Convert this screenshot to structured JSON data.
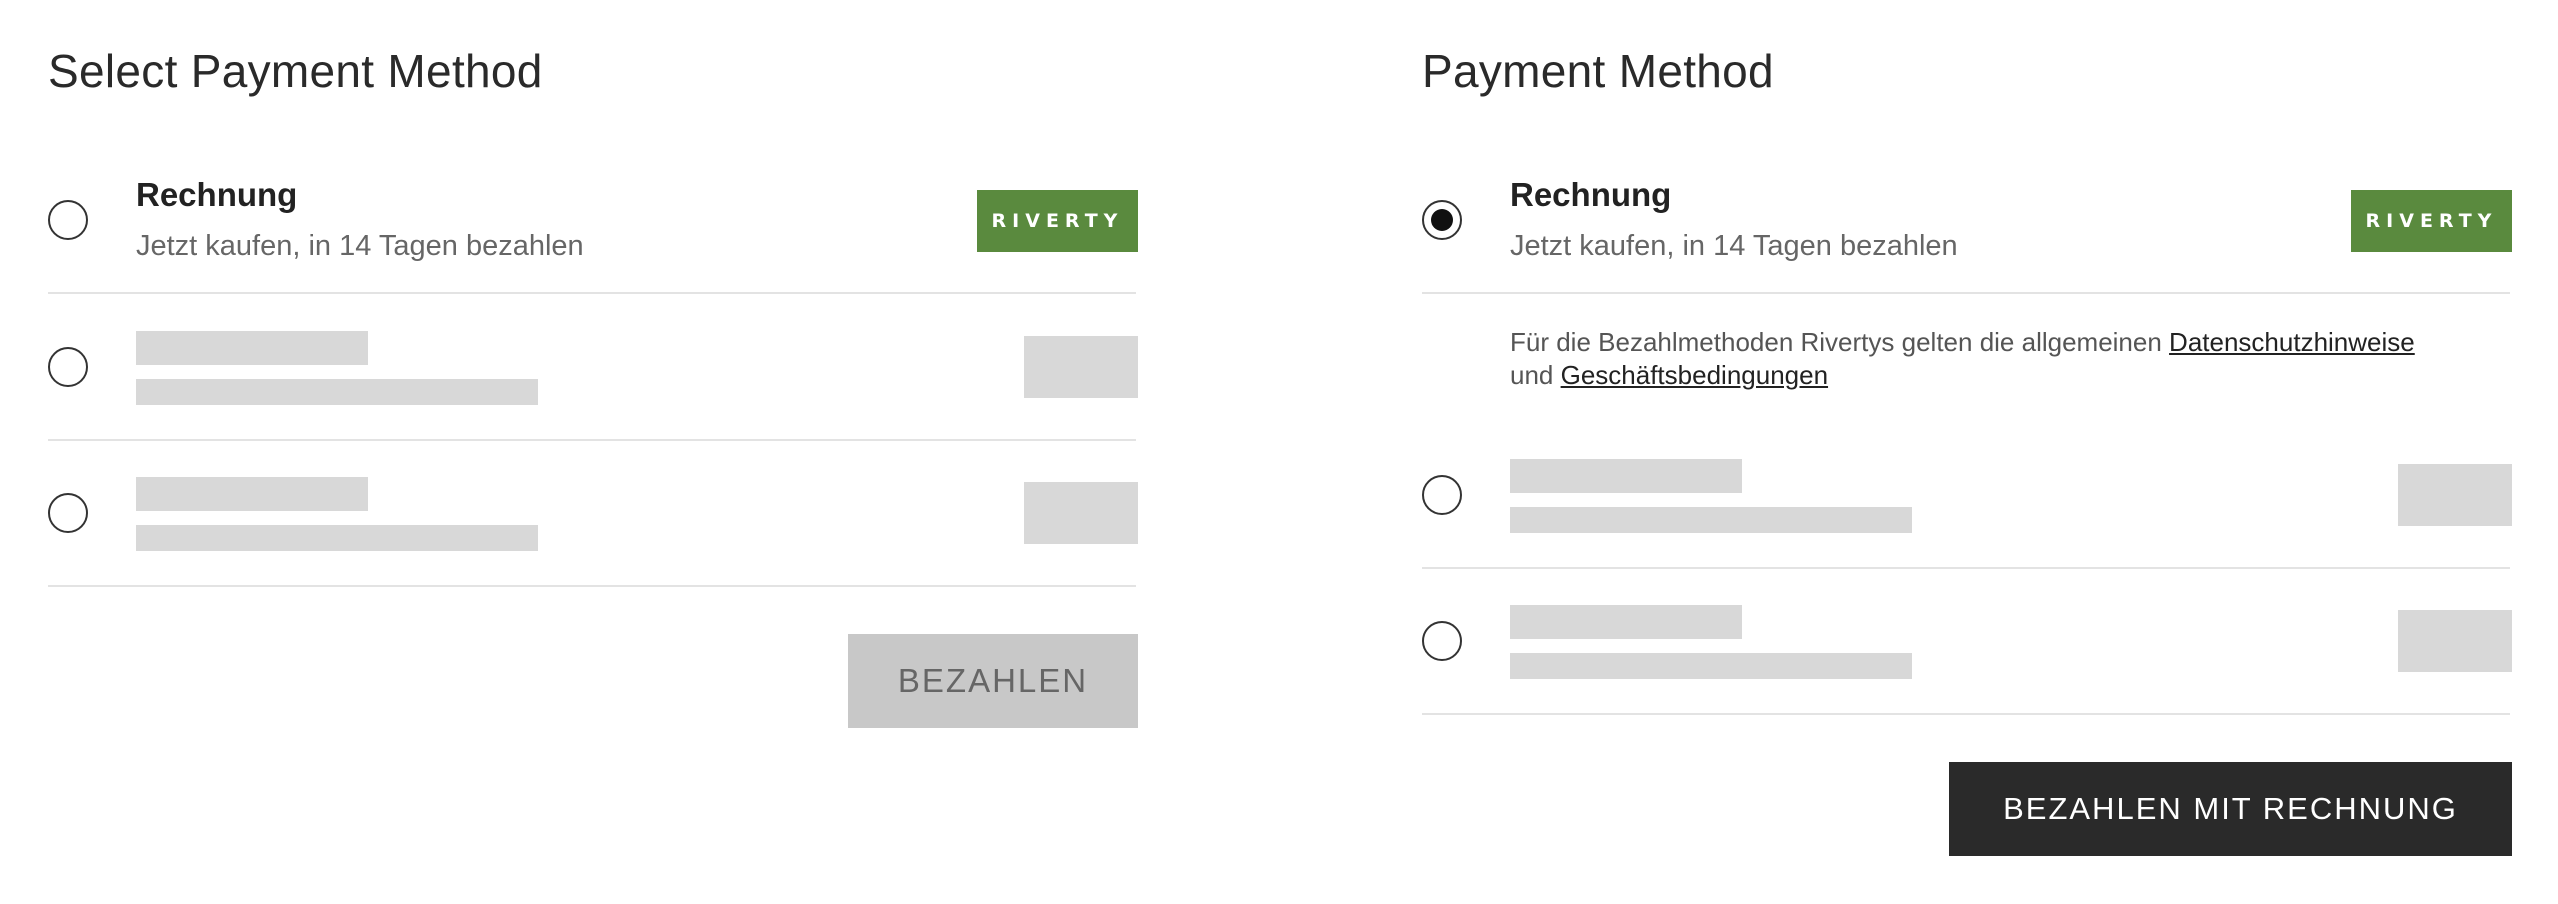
{
  "left_panel": {
    "title": "Select Payment Method",
    "options": [
      {
        "title": "Rechnung",
        "subtitle": "Jetzt kaufen, in 14 Tagen bezahlen",
        "selected": false,
        "logo_text": "RIVERTY",
        "logo_color": "#5a8a3e"
      },
      {
        "placeholder": true,
        "selected": false
      },
      {
        "placeholder": true,
        "selected": false
      }
    ],
    "button": {
      "label": "BEZAHLEN",
      "enabled": false
    }
  },
  "right_panel": {
    "title": "Payment Method",
    "options": [
      {
        "title": "Rechnung",
        "subtitle": "Jetzt kaufen, in 14 Tagen bezahlen",
        "selected": true,
        "logo_text": "RIVERTY",
        "logo_color": "#5a8a3e"
      },
      {
        "placeholder": true,
        "selected": false
      },
      {
        "placeholder": true,
        "selected": false
      }
    ],
    "info": {
      "text_before": "Für die Bezahlmethoden Rivertys gelten die allgemeinen ",
      "link_privacy": "Datenschutzhinweise",
      "text_between": " und ",
      "link_terms": "Geschäftsbedingungen"
    },
    "button": {
      "label": "BEZAHLEN MIT RECHNUNG",
      "enabled": true
    }
  },
  "colors": {
    "accent_logo": "#5a8a3e",
    "primary_button": "#2a2a2a",
    "disabled_button": "#c8c8c8",
    "skeleton": "#d8d8d8",
    "divider": "#e3e3e3"
  }
}
